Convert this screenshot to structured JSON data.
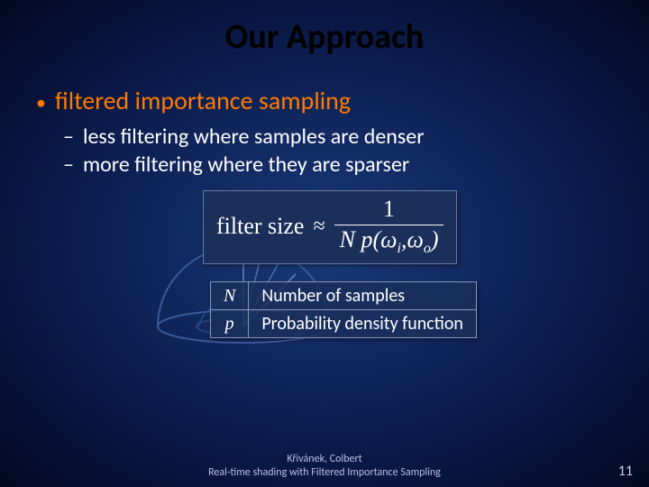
{
  "title": "Our Approach",
  "bullet_main": "filtered importance sampling",
  "sub1": "less filtering where samples are denser",
  "sub2": "more filtering where they are sparser",
  "formula": {
    "lhs": "filter size",
    "approx": "≈",
    "num": "1",
    "den_N": "N",
    "den_p": "p",
    "den_open": "(",
    "den_wi": "ω",
    "den_wi_sub": "i",
    "den_comma": ",",
    "den_wo": "ω",
    "den_wo_sub": "o",
    "den_close": ")"
  },
  "legend": {
    "n_sym": "N",
    "n_desc": "Number of samples",
    "p_sym": "p",
    "p_desc": "Probability density function"
  },
  "footer_line1": "Křivánek, Colbert",
  "footer_line2": "Real-time shading with Filtered Importance Sampling",
  "page_number": "11"
}
